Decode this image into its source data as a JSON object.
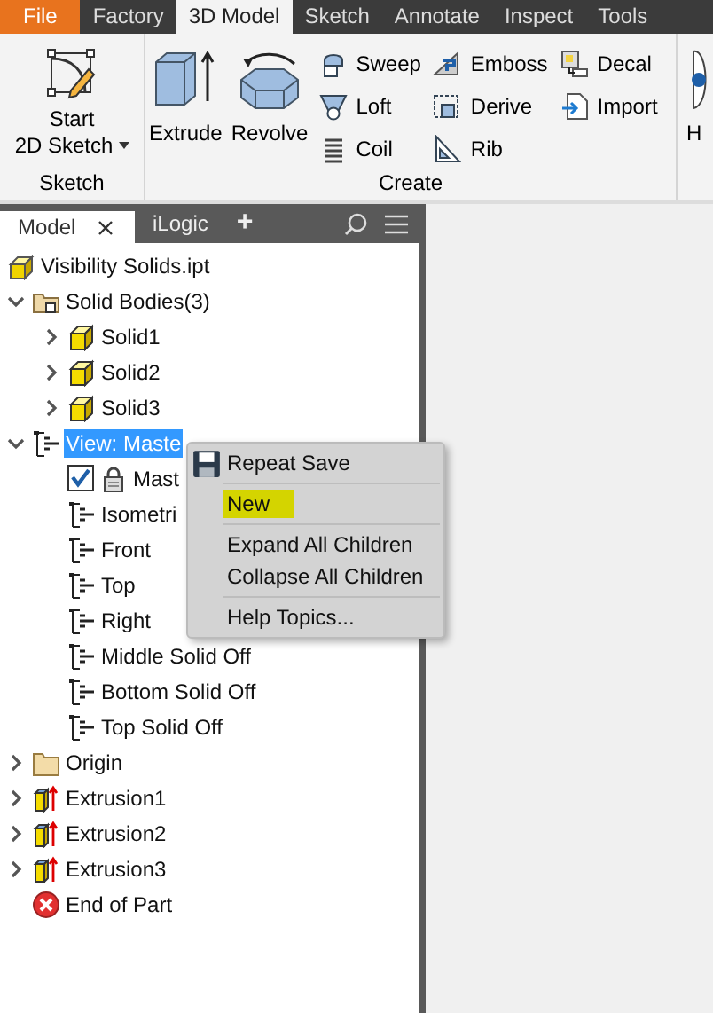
{
  "ribbon": {
    "tabs": [
      {
        "label": "File",
        "kind": "file",
        "selected": false
      },
      {
        "label": "Factory",
        "kind": "tab",
        "selected": false
      },
      {
        "label": "3D Model",
        "kind": "tab",
        "selected": true
      },
      {
        "label": "Sketch",
        "kind": "tab",
        "selected": false
      },
      {
        "label": "Annotate",
        "kind": "tab",
        "selected": false
      },
      {
        "label": "Inspect",
        "kind": "tab",
        "selected": false
      },
      {
        "label": "Tools",
        "kind": "tab",
        "selected": false
      }
    ],
    "groups": [
      {
        "label": "Sketch",
        "large": [
          {
            "label": "Start 2D Sketch",
            "kind": "sketch",
            "dropdown": true
          }
        ]
      },
      {
        "label": "Create",
        "large": [
          {
            "label": "Extrude",
            "kind": "extrude"
          },
          {
            "label": "Revolve",
            "kind": "revolve"
          }
        ],
        "columns": [
          [
            {
              "label": "Sweep",
              "kind": "sweep"
            },
            {
              "label": "Loft",
              "kind": "loft"
            },
            {
              "label": "Coil",
              "kind": "coil"
            }
          ],
          [
            {
              "label": "Emboss",
              "kind": "emboss"
            },
            {
              "label": "Derive",
              "kind": "derive"
            },
            {
              "label": "Rib",
              "kind": "rib"
            }
          ],
          [
            {
              "label": "Decal",
              "kind": "decal"
            },
            {
              "label": "Import",
              "kind": "import"
            }
          ]
        ]
      },
      {
        "large": [
          {
            "label": "H",
            "kind": "hole"
          }
        ]
      }
    ]
  },
  "browser": {
    "tabs": [
      {
        "label": "Model",
        "selected": true,
        "closable": true
      },
      {
        "label": "iLogic",
        "selected": false,
        "closable": false
      }
    ],
    "add_tab": "+",
    "tree": {
      "label": "Visibility Solids.ipt",
      "kind": "part",
      "selected": false,
      "children": [
        {
          "label": "Solid Bodies(3)",
          "kind": "bodies",
          "selected": false,
          "expanded": true,
          "children": [
            {
              "label": "Solid1",
              "kind": "solid",
              "selected": false,
              "expanded": false
            },
            {
              "label": "Solid2",
              "kind": "solid",
              "selected": false,
              "expanded": false
            },
            {
              "label": "Solid3",
              "kind": "solid",
              "selected": false,
              "expanded": false
            }
          ]
        },
        {
          "label": "View: Maste",
          "kind": "view",
          "selected": true,
          "expanded": true,
          "children": [
            {
              "label": "Mast",
              "kind": "master",
              "selected": false,
              "checked": true
            },
            {
              "label": "Isometri",
              "kind": "view",
              "selected": false
            },
            {
              "label": "Front",
              "kind": "view",
              "selected": false
            },
            {
              "label": "Top",
              "kind": "view",
              "selected": false
            },
            {
              "label": "Right",
              "kind": "view",
              "selected": false
            },
            {
              "label": "Middle Solid Off",
              "kind": "view",
              "selected": false
            },
            {
              "label": "Bottom Solid Off",
              "kind": "view",
              "selected": false
            },
            {
              "label": "Top Solid Off",
              "kind": "view",
              "selected": false
            }
          ]
        },
        {
          "label": "Origin",
          "kind": "folder",
          "selected": false,
          "expanded": false
        },
        {
          "label": "Extrusion1",
          "kind": "extrusion",
          "selected": false,
          "expanded": false
        },
        {
          "label": "Extrusion2",
          "kind": "extrusion",
          "selected": false,
          "expanded": false
        },
        {
          "label": "Extrusion3",
          "kind": "extrusion",
          "selected": false,
          "expanded": false
        },
        {
          "label": "End of Part",
          "kind": "end",
          "selected": false
        }
      ]
    }
  },
  "context_menu": {
    "sections": [
      [
        {
          "label": "Repeat Save",
          "kind": "save",
          "highlighted": false
        }
      ],
      [
        {
          "label": "New",
          "kind": "plain",
          "highlighted": true
        }
      ],
      [
        {
          "label": "Expand All Children",
          "kind": "plain",
          "highlighted": false
        },
        {
          "label": "Collapse All Children",
          "kind": "plain",
          "highlighted": false
        }
      ],
      [
        {
          "label": "Help Topics...",
          "kind": "plain",
          "highlighted": false
        }
      ]
    ]
  }
}
